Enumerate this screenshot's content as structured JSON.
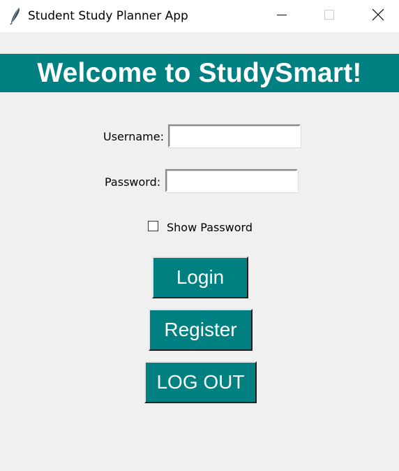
{
  "window": {
    "title": "Student Study Planner App",
    "icon": "feather-icon",
    "controls": [
      "minimize-icon",
      "maximize-icon",
      "close-icon"
    ]
  },
  "banner": {
    "text": "Welcome to StudySmart!",
    "background": "#008080",
    "color": "#ffffff"
  },
  "form": {
    "username_label": "Username:",
    "username_value": "",
    "password_label": "Password:",
    "password_value": "",
    "show_password_label": "Show Password",
    "show_password_checked": false
  },
  "buttons": {
    "login": "Login",
    "register": "Register",
    "logout": "LOG OUT",
    "background": "#008080",
    "color": "#ffffff"
  },
  "colors": {
    "window_bg": "#f0f0f0",
    "accent": "#008080"
  }
}
